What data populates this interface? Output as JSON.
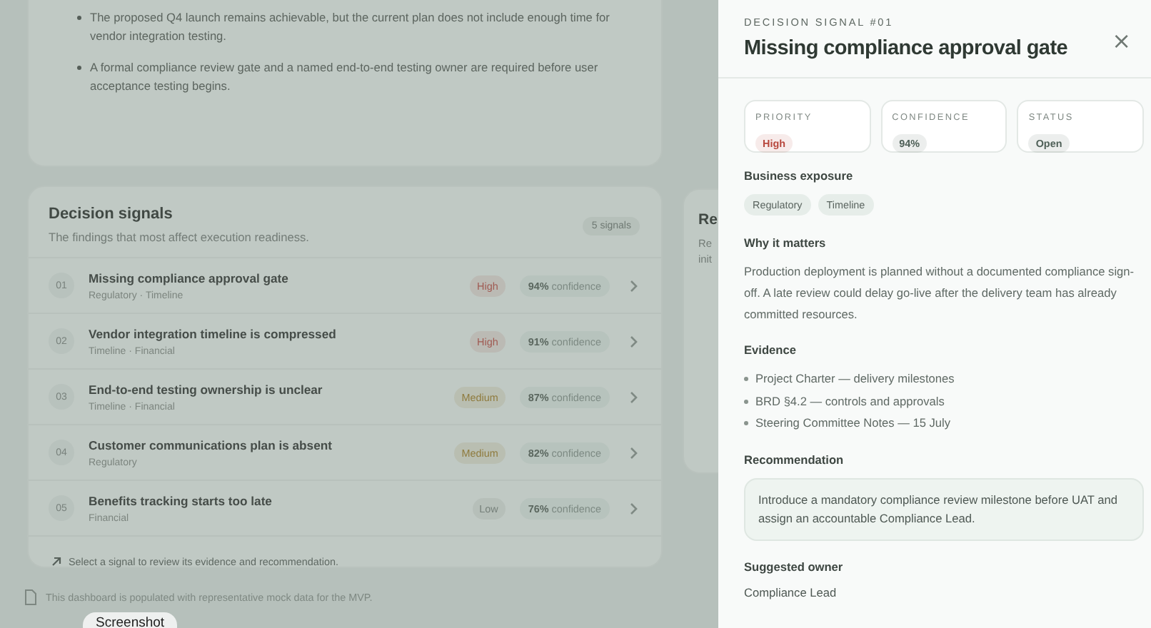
{
  "summary": {
    "bullets": [
      "The proposed Q4 launch remains achievable, but the current plan does not include enough time for vendor integration testing.",
      "A formal compliance review gate and a named end-to-end testing owner are required before user acceptance testing begins."
    ]
  },
  "signals": {
    "title": "Decision signals",
    "subtitle": "The findings that most affect execution readiness.",
    "count": "5 signals",
    "rows": [
      {
        "number": "01",
        "title": "Missing compliance approval gate",
        "tags": "Regulatory · Timeline",
        "priority": "High",
        "color": "#a05a52",
        "confidence": "94%",
        "confidence_label": "confidence"
      },
      {
        "number": "02",
        "title": "Vendor integration timeline is compressed",
        "tags": "Timeline · Financial",
        "priority": "High",
        "color": "#a05a52",
        "confidence": "91%",
        "confidence_label": "confidence"
      },
      {
        "number": "03",
        "title": "End-to-end testing ownership is unclear",
        "tags": "Timeline · Financial",
        "priority": "Medium",
        "color": "#8f7b3e",
        "confidence": "87%",
        "confidence_label": "confidence"
      },
      {
        "number": "04",
        "title": "Customer communications plan is absent",
        "tags": "Regulatory",
        "priority": "Medium",
        "color": "#8f7b3e",
        "confidence": "82%",
        "confidence_label": "confidence"
      },
      {
        "number": "05",
        "title": "Benefits tracking starts too late",
        "tags": "Financial",
        "priority": "Low",
        "color": "#76807a",
        "confidence": "76%",
        "confidence_label": "confidence"
      }
    ],
    "hint": "Select a signal to review its evidence and recommendation."
  },
  "side_card": {
    "title": "Re",
    "lines": [
      "Re",
      "init"
    ]
  },
  "footer_note": "This dashboard is populated with representative mock data for the MVP.",
  "screenshot_label": "Screenshot",
  "panel": {
    "eyebrow": "DECISION SIGNAL #01",
    "title": "Missing compliance approval gate",
    "close": "×",
    "stats": [
      {
        "label": "PRIORITY",
        "value": "High",
        "color": "#b7473d"
      },
      {
        "label": "CONFIDENCE",
        "value": "94%",
        "color": "#4f6058"
      },
      {
        "label": "STATUS",
        "value": "Open",
        "color": "#4f6058"
      }
    ],
    "exposure_heading": "Business exposure",
    "exposure_tags": [
      "Regulatory",
      "Timeline"
    ],
    "why_heading": "Why it matters",
    "why_text": "Production deployment is planned without a documented compliance sign-off. A late review could delay go-live after the delivery team has already committed resources.",
    "evidence_heading": "Evidence",
    "evidence": [
      "Project Charter — delivery milestones",
      "BRD §4.2 — controls and approvals",
      "Steering Committee Notes — 15 July"
    ],
    "recommendation_heading": "Recommendation",
    "recommendation": "Introduce a mandatory compliance review milestone before UAT and assign an accountable Compliance Lead.",
    "owner_heading": "Suggested owner",
    "owner": "Compliance Lead"
  }
}
